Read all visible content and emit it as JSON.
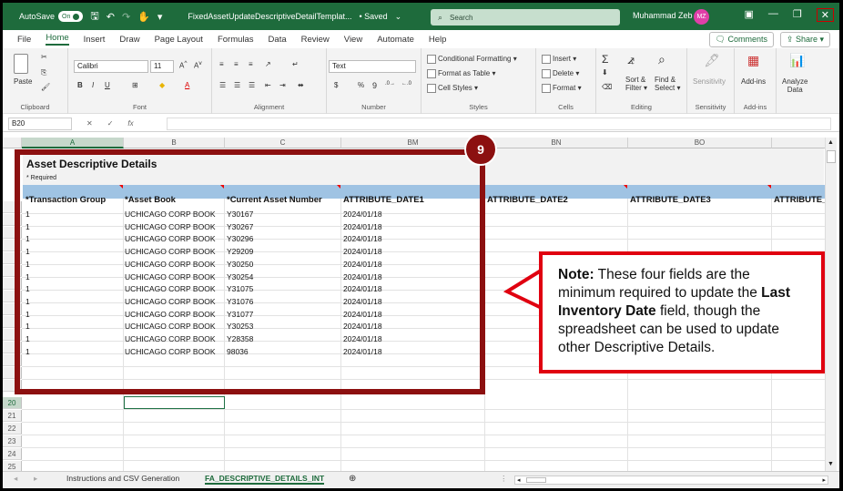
{
  "titlebar": {
    "autosave_label": "AutoSave",
    "autosave_state": "On",
    "filename": "FixedAssetUpdateDescriptiveDetailTemplat...",
    "saved_status": "• Saved",
    "search_placeholder": "Search",
    "user_name": "Muhammad Zeb",
    "user_initials": "MZ"
  },
  "menu": {
    "items": [
      "File",
      "Home",
      "Insert",
      "Draw",
      "Page Layout",
      "Formulas",
      "Data",
      "Review",
      "View",
      "Automate",
      "Help"
    ],
    "active": "Home",
    "comments": "Comments",
    "share": "Share"
  },
  "ribbon": {
    "clipboard": {
      "paste": "Paste",
      "label": "Clipboard"
    },
    "font": {
      "name": "Calibri",
      "size": "11",
      "label": "Font"
    },
    "alignment": {
      "label": "Alignment"
    },
    "number": {
      "format": "Text",
      "label": "Number"
    },
    "styles": {
      "conditional": "Conditional Formatting",
      "table": "Format as Table",
      "cell": "Cell Styles",
      "label": "Styles"
    },
    "cells": {
      "insert": "Insert",
      "delete": "Delete",
      "format": "Format",
      "label": "Cells"
    },
    "editing": {
      "sort": "Sort &",
      "filter": "Filter",
      "find": "Find &",
      "select": "Select",
      "label": "Editing"
    },
    "sensitivity": {
      "text": "Sensitivity",
      "label": "Sensitivity"
    },
    "addins": {
      "text": "Add-ins",
      "label": "Add-ins"
    },
    "analyze": {
      "line1": "Analyze",
      "line2": "Data"
    }
  },
  "formula_bar": {
    "name_box": "B20",
    "fx": "fx",
    "content": ""
  },
  "columns": [
    "A",
    "B",
    "C",
    "BM",
    "BN",
    "BO"
  ],
  "sheet": {
    "title": "Asset Descriptive Details",
    "required_note": "* Required",
    "headers": [
      "*Transaction Group",
      "*Asset Book",
      "*Current Asset Number",
      "ATTRIBUTE_DATE1",
      "ATTRIBUTE_DATE2",
      "ATTRIBUTE_DATE3",
      "ATTRIBUTE_"
    ],
    "rows": [
      [
        "1",
        "UCHICAGO CORP BOOK",
        "Y30167",
        "2024/01/18"
      ],
      [
        "1",
        "UCHICAGO CORP BOOK",
        "Y30267",
        "2024/01/18"
      ],
      [
        "1",
        "UCHICAGO CORP BOOK",
        "Y30296",
        "2024/01/18"
      ],
      [
        "1",
        "UCHICAGO CORP BOOK",
        "Y29209",
        "2024/01/18"
      ],
      [
        "1",
        "UCHICAGO CORP BOOK",
        "Y30250",
        "2024/01/18"
      ],
      [
        "1",
        "UCHICAGO CORP BOOK",
        "Y30254",
        "2024/01/18"
      ],
      [
        "1",
        "UCHICAGO CORP BOOK",
        "Y31075",
        "2024/01/18"
      ],
      [
        "1",
        "UCHICAGO CORP BOOK",
        "Y31076",
        "2024/01/18"
      ],
      [
        "1",
        "UCHICAGO CORP BOOK",
        "Y31077",
        "2024/01/18"
      ],
      [
        "1",
        "UCHICAGO CORP BOOK",
        "Y30253",
        "2024/01/18"
      ],
      [
        "1",
        "UCHICAGO CORP BOOK",
        "Y28358",
        "2024/01/18"
      ],
      [
        "1",
        "UCHICAGO CORP BOOK",
        "98036",
        "2024/01/18"
      ]
    ],
    "row_numbers": [
      "20",
      "21",
      "22",
      "23",
      "24",
      "25"
    ]
  },
  "annotation": {
    "step": "9",
    "note_label": "Note:",
    "note_text_1": "These four fields are the minimum required to update the",
    "note_bold": "Last Inventory Date",
    "note_text_2": "field, though the spreadsheet can be used to update other Descriptive Details."
  },
  "tabs": {
    "items": [
      "Instructions and CSV Generation",
      "FA_DESCRIPTIVE_DETAILS_INT"
    ],
    "active": "FA_DESCRIPTIVE_DETAILS_INT"
  },
  "colors": {
    "excel_green": "#1e6b3c",
    "header_blue": "#9fc3e3",
    "annotation_dark_red": "#8c1010",
    "callout_red": "#e00010"
  }
}
